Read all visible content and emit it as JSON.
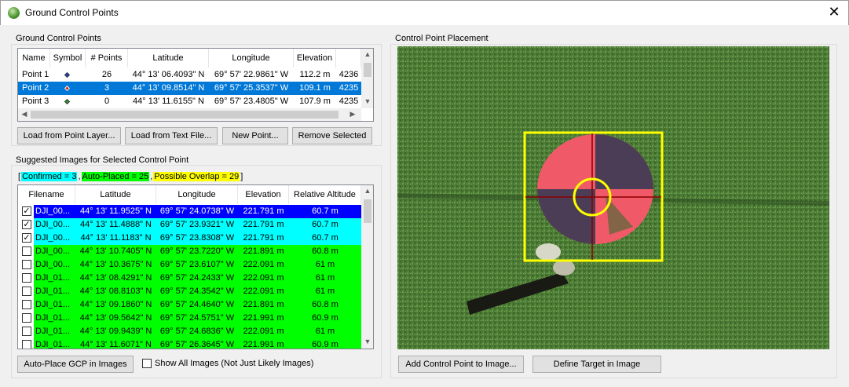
{
  "window": {
    "title": "Ground Control Points"
  },
  "gcp": {
    "group_label": "Ground Control Points",
    "columns": [
      "Name",
      "Symbol",
      "# Points",
      "Latitude",
      "Longitude",
      "Elevation",
      ""
    ],
    "rows": [
      {
        "name": "Point 1",
        "symbol_color": "#1f3fd0",
        "points": "26",
        "lat": "44° 13' 06.4093\" N",
        "lon": "69° 57' 22.9861\" W",
        "elev": "112.2 m",
        "extra": "4236"
      },
      {
        "name": "Point 2",
        "symbol_color": "#c81e1e",
        "points": "3",
        "lat": "44° 13' 09.8514\" N",
        "lon": "69° 57' 25.3537\" W",
        "elev": "109.1 m",
        "extra": "4235"
      },
      {
        "name": "Point 3",
        "symbol_color": "#2fa02f",
        "points": "0",
        "lat": "44° 13' 11.6155\" N",
        "lon": "69° 57' 23.4805\" W",
        "elev": "107.9 m",
        "extra": "4235"
      }
    ],
    "selected_row": 1,
    "buttons": {
      "load_point_layer": "Load from Point Layer...",
      "load_text_file": "Load from Text File...",
      "new_point": "New Point...",
      "remove_selected": "Remove Selected"
    }
  },
  "suggested": {
    "group_label": "Suggested Images for Selected Control Point",
    "legend": {
      "open": "[",
      "confirmed": "Confirmed = 3",
      "sep1": ",",
      "autoplaced": "Auto-Placed = 25",
      "sep2": ",",
      "overlap": "Possible Overlap = 29",
      "close": "]"
    },
    "colors": {
      "selected": "#0000ff",
      "confirmed": "#00ffff",
      "autoplaced": "#00ff00",
      "overlap": "#ffff00"
    },
    "columns": [
      "Filename",
      "Latitude",
      "Longitude",
      "Elevation",
      "Relative Altitude"
    ],
    "rows": [
      {
        "checked": true,
        "status": "selected",
        "file": "DJI_00...",
        "lat": "44° 13' 11.9525\" N",
        "lon": "69° 57' 24.0738\" W",
        "elev": "221.791 m",
        "rel": "60.7 m"
      },
      {
        "checked": true,
        "status": "confirmed",
        "file": "DJI_00...",
        "lat": "44° 13' 11.4888\" N",
        "lon": "69° 57' 23.9321\" W",
        "elev": "221.791 m",
        "rel": "60.7 m"
      },
      {
        "checked": true,
        "status": "confirmed",
        "file": "DJI_00...",
        "lat": "44° 13' 11.1183\" N",
        "lon": "69° 57' 23.8308\" W",
        "elev": "221.791 m",
        "rel": "60.7 m"
      },
      {
        "checked": false,
        "status": "autoplaced",
        "file": "DJI_00...",
        "lat": "44° 13' 10.7405\" N",
        "lon": "69° 57' 23.7220\" W",
        "elev": "221.891 m",
        "rel": "60.8 m"
      },
      {
        "checked": false,
        "status": "autoplaced",
        "file": "DJI_00...",
        "lat": "44° 13' 10.3675\" N",
        "lon": "69° 57' 23.6107\" W",
        "elev": "222.091 m",
        "rel": "61 m"
      },
      {
        "checked": false,
        "status": "autoplaced",
        "file": "DJI_01...",
        "lat": "44° 13' 08.4291\" N",
        "lon": "69° 57' 24.2433\" W",
        "elev": "222.091 m",
        "rel": "61 m"
      },
      {
        "checked": false,
        "status": "autoplaced",
        "file": "DJI_01...",
        "lat": "44° 13' 08.8103\" N",
        "lon": "69° 57' 24.3542\" W",
        "elev": "222.091 m",
        "rel": "61 m"
      },
      {
        "checked": false,
        "status": "autoplaced",
        "file": "DJI_01...",
        "lat": "44° 13' 09.1860\" N",
        "lon": "69° 57' 24.4640\" W",
        "elev": "221.891 m",
        "rel": "60.8 m"
      },
      {
        "checked": false,
        "status": "autoplaced",
        "file": "DJI_01...",
        "lat": "44° 13' 09.5642\" N",
        "lon": "69° 57' 24.5751\" W",
        "elev": "221.991 m",
        "rel": "60.9 m"
      },
      {
        "checked": false,
        "status": "autoplaced",
        "file": "DJI_01...",
        "lat": "44° 13' 09.9439\" N",
        "lon": "69° 57' 24.6836\" W",
        "elev": "222.091 m",
        "rel": "61 m"
      },
      {
        "checked": false,
        "status": "autoplaced",
        "file": "DJI_01...",
        "lat": "44° 13' 11.6071\" N",
        "lon": "69° 57' 26.3645\" W",
        "elev": "221.991 m",
        "rel": "60.9 m"
      }
    ],
    "auto_place_button": "Auto-Place GCP in Images",
    "show_all_label": "Show All Images (Not Just Likely Images)",
    "show_all_checked": false
  },
  "placement": {
    "group_label": "Control Point Placement",
    "add_button": "Add Control Point to Image...",
    "define_button": "Define Target in Image"
  }
}
